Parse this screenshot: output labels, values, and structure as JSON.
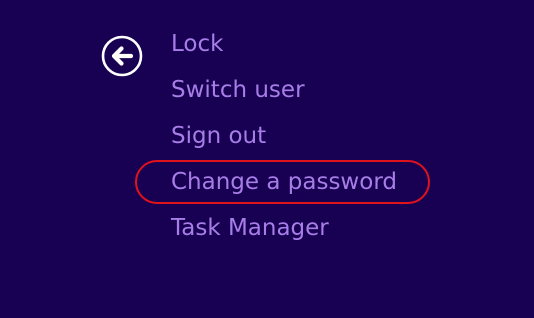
{
  "screen": {
    "background_color": "#180052",
    "text_color": "#a77ee8"
  },
  "back_button": {
    "icon": "arrow-left-circle-icon",
    "color": "#ffffff"
  },
  "menu": {
    "items": [
      {
        "label": "Lock"
      },
      {
        "label": "Switch user"
      },
      {
        "label": "Sign out"
      },
      {
        "label": "Change a password"
      },
      {
        "label": "Task Manager"
      }
    ]
  },
  "annotation": {
    "highlighted_item": "Change a password",
    "color": "#e0121b"
  }
}
